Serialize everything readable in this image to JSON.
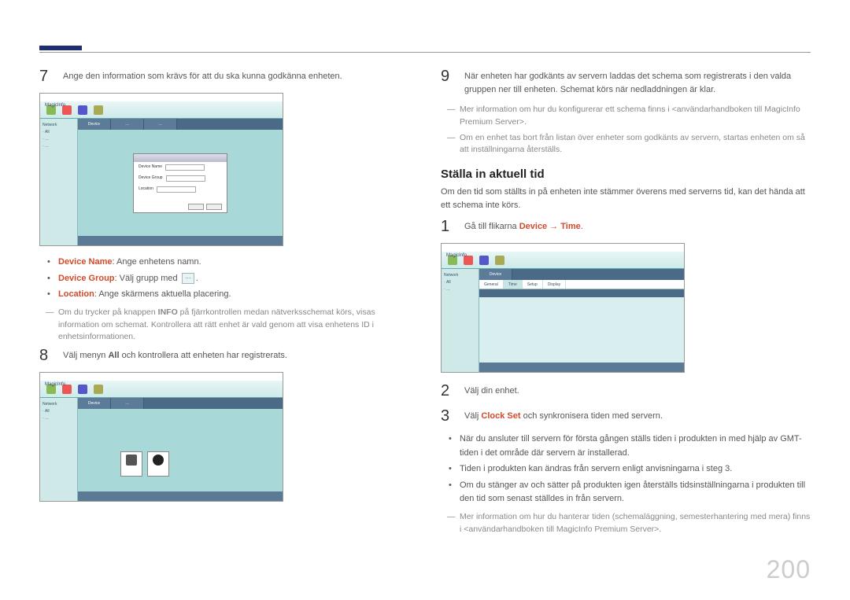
{
  "steps_left": {
    "s7": "Ange den information som krävs för att du ska kunna godkänna enheten.",
    "s8_pre": "Välj menyn ",
    "s8_all": "All",
    "s8_post": " och kontrollera att enheten har registrerats."
  },
  "bullets_left": {
    "b1_label": "Device Name",
    "b1_text": ": Ange enhetens namn.",
    "b2_label": "Device Group",
    "b2_text": ": Välj grupp med ",
    "b2_after": ".",
    "b3_label": "Location",
    "b3_text": ": Ange skärmens aktuella placering."
  },
  "note_left_pre": "Om du trycker på knappen ",
  "note_left_info": "INFO",
  "note_left_post": " på fjärrkontrollen medan nätverksschemat körs, visas information om schemat. Kontrollera att rätt enhet är vald genom att visa enhetens ID i enhetsinformationen.",
  "right": {
    "s9": "När enheten har godkänts av servern laddas det schema som registrerats i den valda gruppen ner till enheten. Schemat körs när nedladdningen är klar.",
    "note1": "Mer information om hur du konfigurerar ett schema finns i <användarhandboken till MagicInfo Premium Server>.",
    "note2": "Om en enhet tas bort från listan över enheter som godkänts av servern, startas enheten om så att inställningarna återställs.",
    "section_title": "Ställa in aktuell tid",
    "section_intro": "Om den tid som ställts in på enheten inte stämmer överens med serverns tid, kan det hända att ett schema inte körs.",
    "s1_pre": "Gå till flikarna ",
    "s1_link": "Device → Time",
    "s1_post": ".",
    "s2": "Välj din enhet.",
    "s3_pre": "Välj ",
    "s3_link": "Clock Set",
    "s3_post": " och synkronisera tiden med servern.",
    "bul1": "När du ansluter till servern för första gången ställs tiden i produkten in med hjälp av GMT-tiden i det område där servern är installerad.",
    "bul2": "Tiden i produkten kan ändras från servern enligt anvisningarna i steg 3.",
    "bul3": "Om du stänger av och sätter på produkten igen återställs tidsinställningarna i produkten till den tid som senast ställdes in från servern.",
    "note3": "Mer information om hur du hanterar tiden (schemaläggning, semesterhantering med mera) finns i <användarhandboken till MagicInfo Premium Server>."
  },
  "page_number": "200",
  "screenshot_label": "MagicInfo"
}
